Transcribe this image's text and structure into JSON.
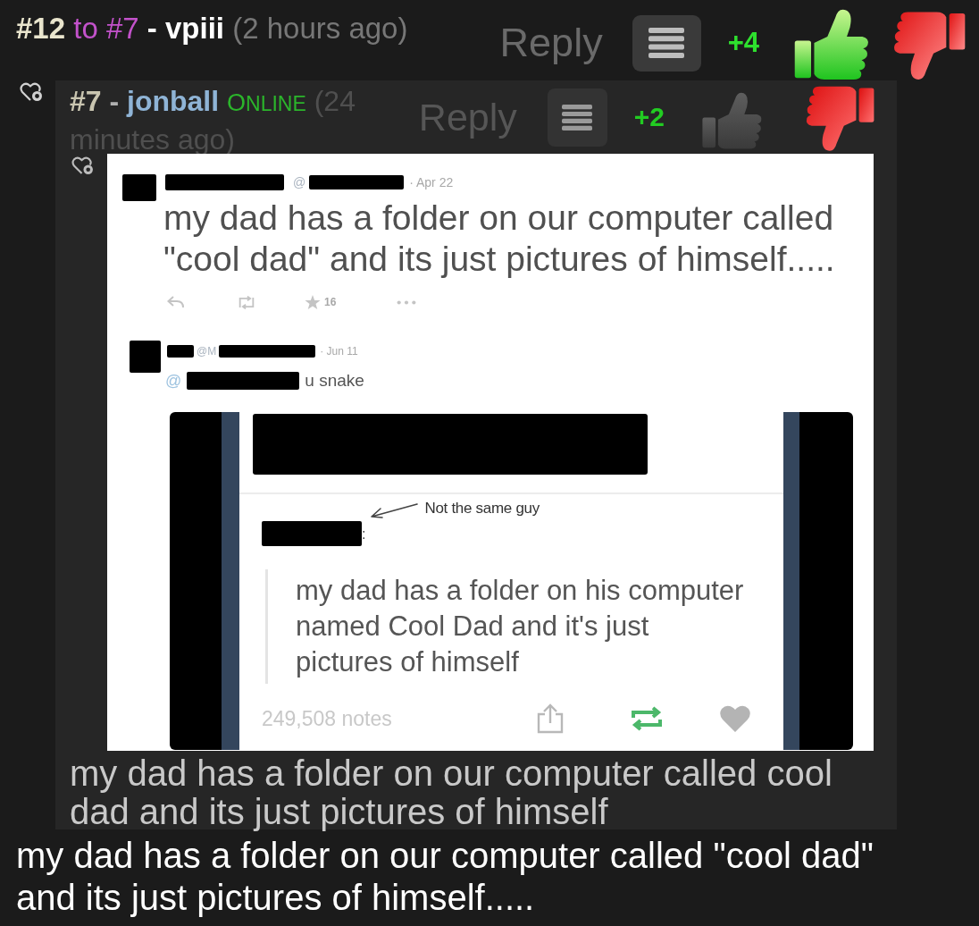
{
  "comment": {
    "number": "#12",
    "reply_to": "to #7",
    "separator": "-",
    "author": "vpiii",
    "time": "(2 hours ago)",
    "reply_label": "Reply",
    "score": "+4",
    "upvoted": true
  },
  "quoted_comment": {
    "number": "#7",
    "separator": "-",
    "author": "jonball",
    "status": "ONLINE",
    "time": "(24 minutes ago)",
    "reply_label": "Reply",
    "score": "+2",
    "upvoted": false,
    "screenshot": {
      "tweet": {
        "handle": "@",
        "date": "· Apr 22",
        "text": "my dad has a folder on our computer called \"cool dad\" and its just pictures of himself.....",
        "star_count": "16"
      },
      "reply": {
        "handle": "@M",
        "date": "· Jun 11",
        "mention": "@",
        "text": "u snake"
      },
      "post": {
        "annotation": "Not the same guy",
        "colon": ":",
        "quote": "my dad has a folder on his computer named Cool Dad and it's just pictures of himself",
        "notes": "249,508 notes"
      }
    },
    "caption": "my dad has a folder on our computer called cool dad and its just pictures of himself"
  },
  "body": "my dad has a folder on our computer called \"cool dad\" and its just pictures of himself....."
}
